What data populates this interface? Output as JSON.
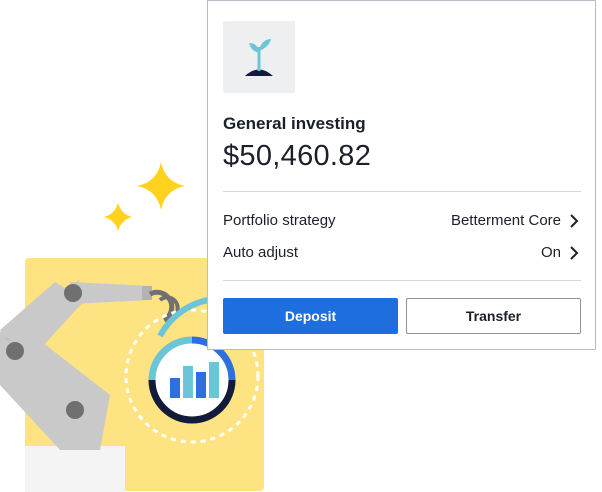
{
  "account": {
    "title": "General investing",
    "balance": "$50,460.82",
    "icon": "sprout-icon"
  },
  "details": [
    {
      "label": "Portfolio strategy",
      "value": "Betterment Core",
      "icon": "chevron-right-icon"
    },
    {
      "label": "Auto adjust",
      "value": "On",
      "icon": "chevron-right-icon"
    }
  ],
  "actions": {
    "deposit_label": "Deposit",
    "transfer_label": "Transfer"
  },
  "colors": {
    "primary": "#1f6ee0",
    "sparkle": "#ffd21f",
    "panel_yellow": "#fde382",
    "teal": "#6cc5d6",
    "navy": "#131b3a",
    "robot_gray": "#c8c8c8"
  }
}
